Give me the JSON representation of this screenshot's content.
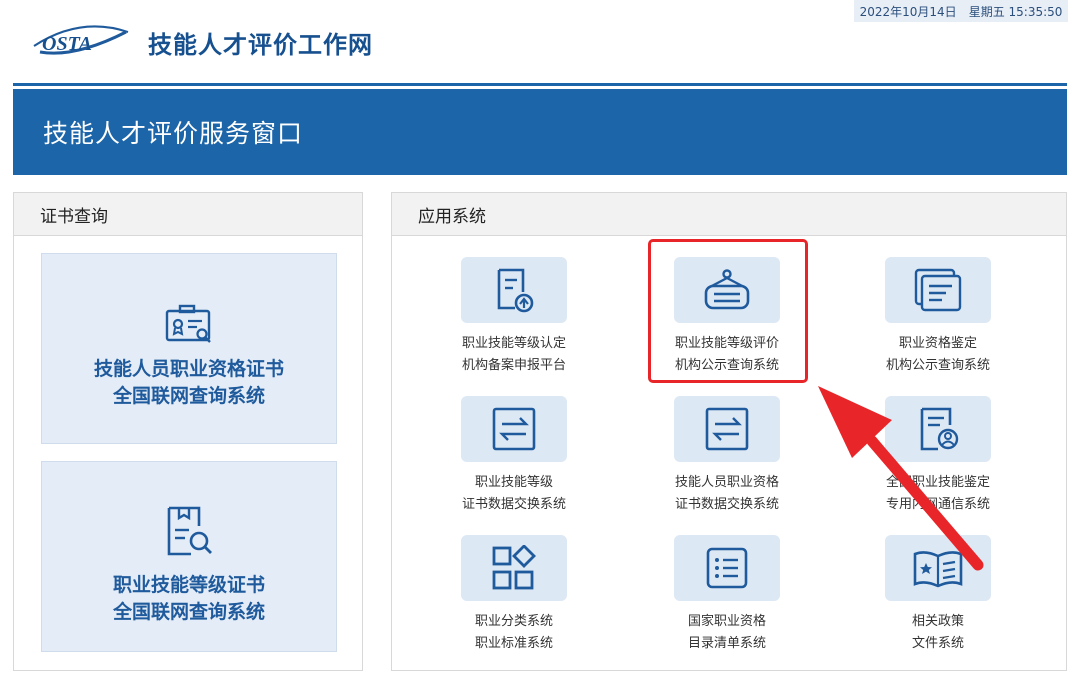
{
  "datetime": {
    "date": "2022年10月14日",
    "time": "星期五 15:35:50"
  },
  "header": {
    "logo_text": "OSTA",
    "site_title": "技能人才评价工作网"
  },
  "banner": {
    "title": "技能人才评价服务窗口"
  },
  "left_panel": {
    "title": "证书查询",
    "cards": [
      {
        "icon": "certificate-search-icon",
        "line1": "技能人员职业资格证书",
        "line2": "全国联网查询系统"
      },
      {
        "icon": "document-search-icon",
        "line1": "职业技能等级证书",
        "line2": "全国联网查询系统"
      }
    ]
  },
  "right_panel": {
    "title": "应用系统",
    "apps": [
      {
        "icon": "document-upload-icon",
        "line1": "职业技能等级认定",
        "line2": "机构备案申报平台"
      },
      {
        "icon": "notice-board-icon",
        "line1": "职业技能等级评价",
        "line2": "机构公示查询系统"
      },
      {
        "icon": "stacked-documents-icon",
        "line1": "职业资格鉴定",
        "line2": "机构公示查询系统"
      },
      {
        "icon": "exchange-icon",
        "line1": "职业技能等级",
        "line2": "证书数据交换系统"
      },
      {
        "icon": "exchange-icon",
        "line1": "技能人员职业资格",
        "line2": "证书数据交换系统"
      },
      {
        "icon": "user-document-icon",
        "line1": "全国职业技能鉴定",
        "line2": "专用内网通信系统"
      },
      {
        "icon": "categories-icon",
        "line1": "职业分类系统",
        "line2": "职业标准系统"
      },
      {
        "icon": "list-icon",
        "line1": "国家职业资格",
        "line2": "目录清单系统"
      },
      {
        "icon": "policy-book-icon",
        "line1": "相关政策",
        "line2": "文件系统"
      }
    ]
  },
  "colors": {
    "brand_blue": "#1c65a8",
    "card_bg": "#e3ecf7",
    "highlight_red": "#e8262a"
  }
}
